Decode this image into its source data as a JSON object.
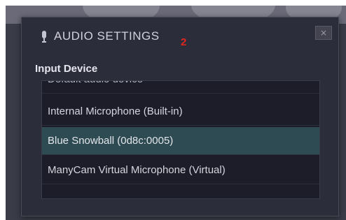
{
  "dialog": {
    "title": "AUDIO SETTINGS",
    "step_marker": "2",
    "close_label": "×",
    "icon": "microphone-icon"
  },
  "input_device": {
    "label": "Input Device",
    "items": [
      {
        "label": "Default audio device",
        "selected": false
      },
      {
        "label": "Internal Microphone (Built-in)",
        "selected": false
      },
      {
        "label": "Blue Snowball (0d8c:0005)",
        "selected": true
      },
      {
        "label": "ManyCam Virtual Microphone (Virtual)",
        "selected": false
      }
    ]
  },
  "colors": {
    "dialog_bg": "#2c2d3a",
    "list_bg": "#1c1d28",
    "selected_row": "#2e4a52",
    "step_marker": "#e0271f"
  }
}
